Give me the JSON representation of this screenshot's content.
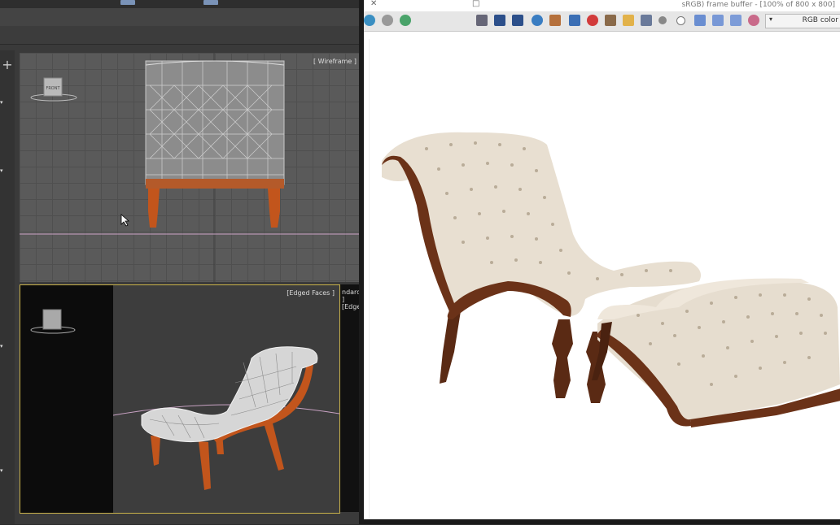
{
  "max_viewports": {
    "front": {
      "label": "[ Wireframe ]",
      "viewcube_label": "FRONT"
    },
    "perspective": {
      "label": "[Edged Faces ]"
    },
    "side_strip": {
      "label": "ndard ] [Edged"
    }
  },
  "frame_buffer": {
    "title": "sRGB) frame buffer - [100% of 800 x 800]",
    "channel_select": "RGB color",
    "close_glyph": "✕",
    "restore_glyph": "□",
    "toolbar_icons": [
      "save-image-icon",
      "copy-image-icon",
      "clone-window-icon",
      "reset-icon",
      "zoom-icon",
      "track-mouse-icon",
      "clear-icon",
      "stop-render-icon",
      "region-render-icon",
      "load-icon",
      "save-icon",
      "color-picker-icon",
      "white-dot-icon",
      "mono-icon",
      "rgb-red-icon",
      "rgb-green-icon",
      "rgb-blue-icon",
      "alpha-icon"
    ]
  },
  "colors": {
    "viewport_grid_bg": "#5a5a5a",
    "active_viewport_border": "#c9b24a",
    "wood": "#6b3218",
    "upholstery": "#e5ddcf",
    "wireframe_legs": "#c2551c"
  }
}
